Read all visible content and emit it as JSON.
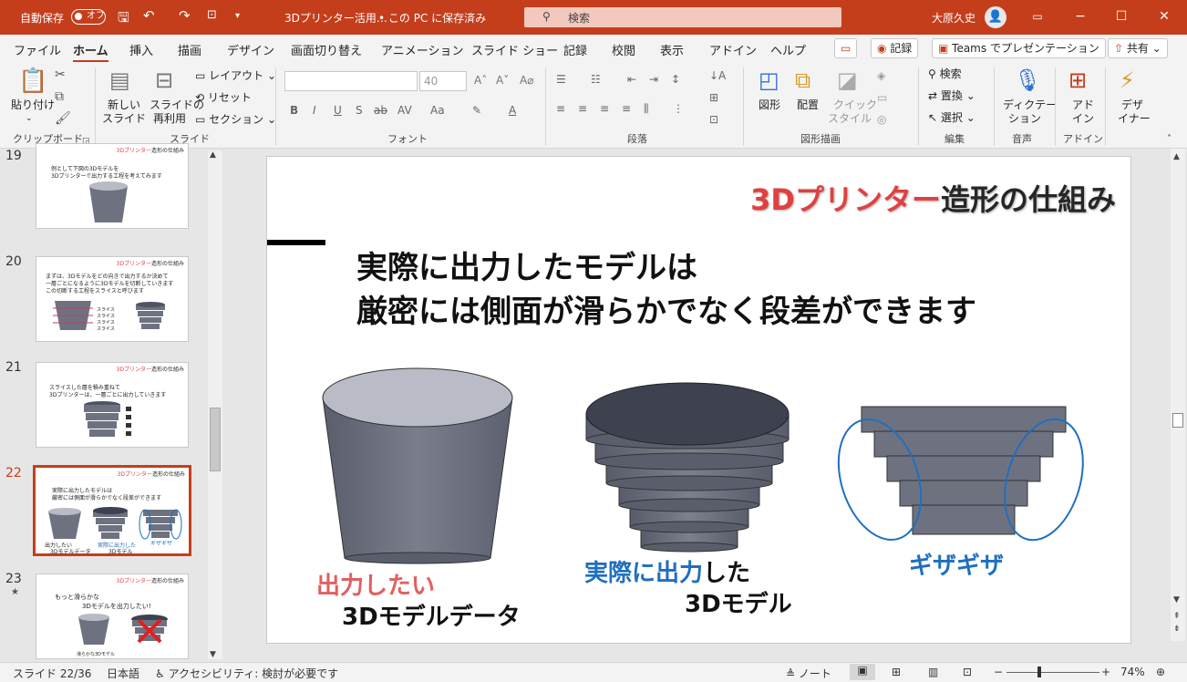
{
  "titlebar": {
    "autosave_label": "自動保存",
    "autosave_state": "オフ",
    "doc_title": "3Dプリンター活用…",
    "save_location": "• この PC に保存済み",
    "search_placeholder": "検索",
    "user_name": "大原久史"
  },
  "menu": {
    "tabs": [
      "ファイル",
      "ホーム",
      "挿入",
      "描画",
      "デザイン",
      "画面切り替え",
      "アニメーション",
      "スライド ショー",
      "記録",
      "校閲",
      "表示",
      "アドイン",
      "ヘルプ"
    ],
    "record_button": "記録",
    "teams_button": "Teams でプレゼンテーション",
    "share_button": "共有"
  },
  "ribbon": {
    "paste": "貼り付け",
    "clipboard_group": "クリップボード",
    "new_slide": [
      "新しい",
      "スライド"
    ],
    "reuse_slide": [
      "スライドの",
      "再利用"
    ],
    "layout": "レイアウト",
    "reset": "リセット",
    "section": "セクション",
    "slides_group": "スライド",
    "font_size": "40",
    "font_group": "フォント",
    "paragraph_group": "段落",
    "shape": "図形",
    "arrange": "配置",
    "quick_style": [
      "クイック",
      "スタイル"
    ],
    "drawing_group": "図形描画",
    "find": "検索",
    "replace": "置換",
    "select": "選択",
    "editing_group": "編集",
    "dictate": [
      "ディクテー",
      "ション"
    ],
    "voice_group": "音声",
    "addin": [
      "アド",
      "イン"
    ],
    "addin_group": "アドイン",
    "designer": [
      "デザ",
      "イナー"
    ]
  },
  "thumbnails": [
    {
      "num": "19",
      "title_red": "3Dプリンター",
      "title_black": "造形の仕組み",
      "lines": [
        "例として下図の3Dモデルを",
        "3Dプリンターで出力する工程を考えてみます"
      ]
    },
    {
      "num": "20",
      "title_red": "3Dプリンター",
      "title_black": "造形の仕組み",
      "lines": [
        "まずは、3Dモデルをどの向きで出力するか決めて",
        "一層ごとになるように3Dモデルを切断していきます",
        "この切断する工程をスライスと呼びます"
      ],
      "labels": [
        "スライス",
        "スライス",
        "スライス",
        "スライス"
      ]
    },
    {
      "num": "21",
      "title_red": "3Dプリンター",
      "title_black": "造形の仕組み",
      "lines": [
        "スライスした層を積み重ねて",
        "3Dプリンターは、一層ごとに出力していきます"
      ]
    },
    {
      "num": "22",
      "title_red": "3Dプリンター",
      "title_black": "造形の仕組み",
      "lines": [
        "実際に出力したモデルは",
        "厳密には側面が滑らかでなく段差ができます"
      ],
      "captions": [
        "出力したい",
        "3Dモデルデータ",
        "実際に出力した",
        "3Dモデル",
        "ギザギザ"
      ]
    },
    {
      "num": "23",
      "star": "★",
      "title_red": "3Dプリンター",
      "title_black": "造形の仕組み",
      "lines": [
        "もっと滑らかな",
        "3Dモデルを出力したい!"
      ],
      "caption": "滑らかな3Dモデル"
    }
  ],
  "slide": {
    "title_red": "3Dプリンター",
    "title_black": "造形の仕組み",
    "heading_line1": "実際に出力したモデルは",
    "heading_line2": "厳密には側面が滑らかでなく段差ができます",
    "caption1_red": "出力したい",
    "caption1_black": "3Dモデルデータ",
    "caption2_blue": "実際に出力",
    "caption2_black": "した",
    "caption2_line2": "3Dモデル",
    "caption3": "ギザギザ"
  },
  "status": {
    "slide_info": "スライド 22/36",
    "language": "日本語",
    "accessibility": "アクセシビリティ: 検討が必要です",
    "notes": "ノート",
    "zoom": "74%"
  },
  "colors": {
    "accent": "#c43e1c",
    "red": "#e04040",
    "blue": "#1f6fc0",
    "model": "#6e7280"
  }
}
